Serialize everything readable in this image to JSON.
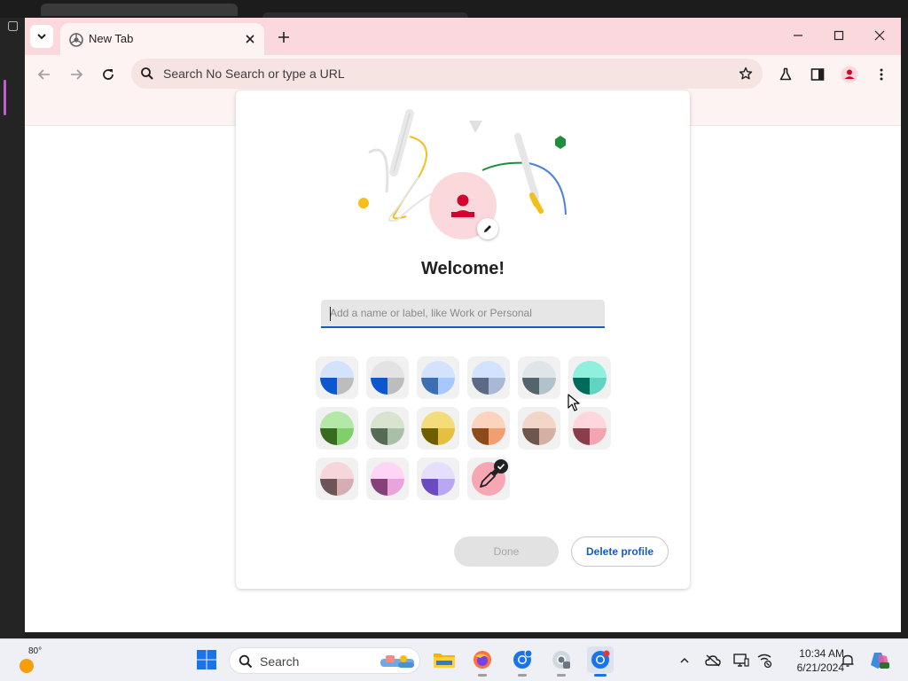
{
  "browser": {
    "tab": {
      "title": "New Tab"
    },
    "omnibox": {
      "text": "Search No Search or type a URL"
    }
  },
  "dialog": {
    "heading": "Welcome!",
    "name_input": {
      "placeholder": "Add a name or label, like Work or Personal",
      "value": ""
    },
    "color_swatches": [
      {
        "name": "blue-default",
        "top": "#d3e3fd",
        "left": "#0b57d0",
        "right": "#bdbdbd"
      },
      {
        "name": "grey-blue",
        "top": "#e3e3e3",
        "left": "#0b57d0",
        "right": "#bdbdbd"
      },
      {
        "name": "blue",
        "top": "#d3e3fd",
        "left": "#3c6eb4",
        "right": "#a8c7fa"
      },
      {
        "name": "slate",
        "top": "#d3e3fd",
        "left": "#5b6b85",
        "right": "#a8b8d6"
      },
      {
        "name": "grey",
        "top": "#dfe6ea",
        "left": "#53646d",
        "right": "#b1c2cb"
      },
      {
        "name": "aqua",
        "top": "#8ef0dd",
        "left": "#006b5c",
        "right": "#5fd4c0"
      },
      {
        "name": "green",
        "top": "#b4e8a8",
        "left": "#386a20",
        "right": "#7fcf6a"
      },
      {
        "name": "sage",
        "top": "#d7e4d0",
        "left": "#566a56",
        "right": "#aabfa8"
      },
      {
        "name": "yellow",
        "top": "#f5dc7a",
        "left": "#6d5e00",
        "right": "#e5c040"
      },
      {
        "name": "orange",
        "top": "#fdd3bd",
        "left": "#8c4a1a",
        "right": "#f0a070"
      },
      {
        "name": "taupe",
        "top": "#f4d6c9",
        "left": "#6e564c",
        "right": "#d4b0a2"
      },
      {
        "name": "rose",
        "top": "#ffd6dc",
        "left": "#8a3d4a",
        "right": "#f2a4b1"
      },
      {
        "name": "mauve",
        "top": "#f6d6da",
        "left": "#6d5457",
        "right": "#d4aeb3"
      },
      {
        "name": "pink",
        "top": "#ffd5f5",
        "left": "#84417a",
        "right": "#e9a4dc"
      },
      {
        "name": "violet",
        "top": "#e5defe",
        "left": "#6a4bc0",
        "right": "#b9a7f2"
      },
      {
        "name": "custom-picker",
        "selected": true
      }
    ],
    "done_label": "Done",
    "delete_label": "Delete profile"
  },
  "taskbar": {
    "weather_temp": "80°",
    "search_label": "Search",
    "clock_time": "10:34 AM",
    "clock_date": "6/21/2024"
  },
  "colors": {
    "tabstrip": "#fbd8dc",
    "toolbar": "#fdf3f2",
    "accent": "#1a5bb8",
    "avatar": "#d6002e"
  }
}
